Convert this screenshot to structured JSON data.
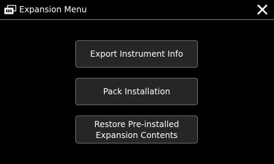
{
  "window": {
    "title": "Expansion Menu",
    "title_icon": "expansion-pack-icon",
    "close_icon": "close-icon",
    "divider_color": "#4f8a54"
  },
  "menu": {
    "export_label": "Export Instrument Info",
    "pack_install_label": "Pack Installation",
    "restore_label_line1": "Restore Pre-installed",
    "restore_label_line2": "Expansion Contents"
  },
  "colors": {
    "background": "#000000",
    "button_fill": "#262626",
    "button_border": "#6a6a6a",
    "text": "#ffffff"
  }
}
